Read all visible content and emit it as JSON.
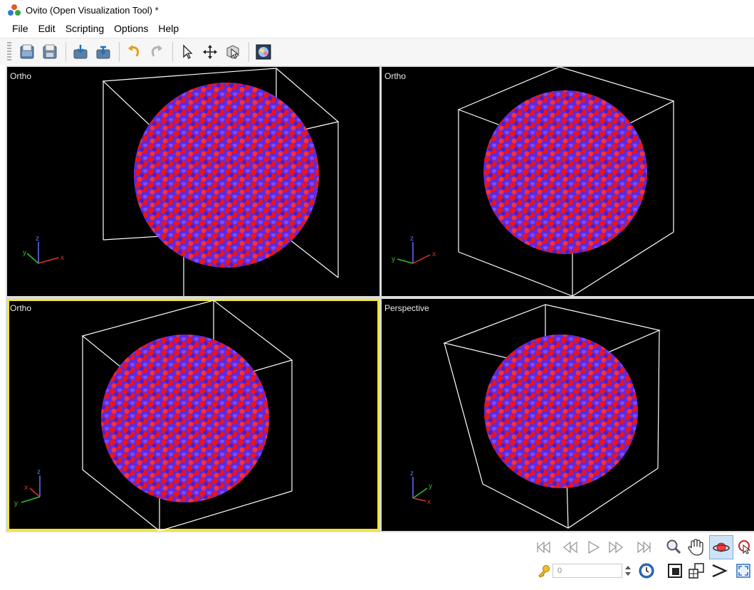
{
  "window": {
    "title": "Ovito (Open Visualization Tool) *"
  },
  "menu": {
    "items": [
      "File",
      "Edit",
      "Scripting",
      "Options",
      "Help"
    ]
  },
  "toolbar": {
    "buttons": [
      "open-file",
      "save-file",
      "import",
      "export",
      "undo",
      "redo",
      "selection-mode",
      "move-mode",
      "pick-orbit",
      "render"
    ]
  },
  "viewports": [
    {
      "caption": "Ortho",
      "axes": {
        "z": "z",
        "y": "y",
        "x": "x"
      }
    },
    {
      "caption": "Ortho",
      "axes": {
        "z": "z",
        "y": "y",
        "x": "x"
      }
    },
    {
      "caption": "Ortho",
      "axes": {
        "z": "z",
        "y": "y",
        "x": "x"
      }
    },
    {
      "caption": "Perspective",
      "axes": {
        "z": "z",
        "y": "y",
        "x": "x"
      }
    }
  ],
  "animation": {
    "current_frame": "0"
  },
  "colors": {
    "atom_red": "#e8141e",
    "atom_blue": "#5a2ae6",
    "active_border": "#f2e43a",
    "axis_x": "#e03030",
    "axis_y": "#30c030",
    "axis_z": "#6070ff"
  }
}
